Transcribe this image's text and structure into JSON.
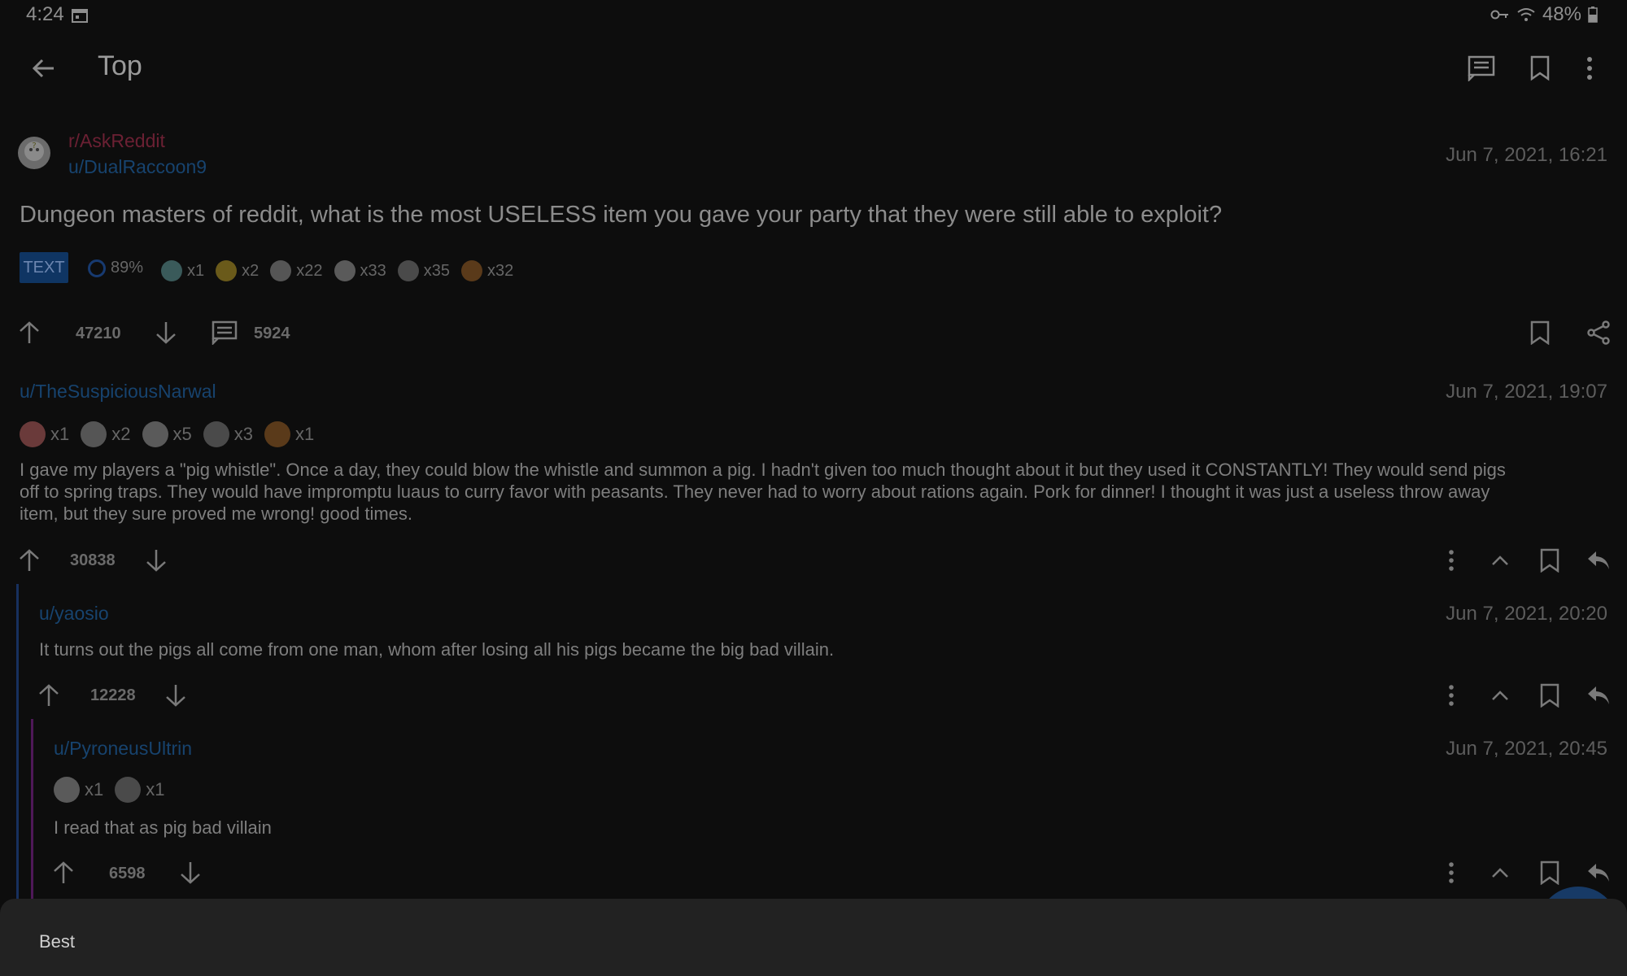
{
  "status_bar": {
    "time": "4:24",
    "battery": "48%"
  },
  "toolbar": {
    "title": "Top"
  },
  "post": {
    "subreddit": "r/AskReddit",
    "author": "u/DualRaccoon9",
    "date": "Jun 7, 2021, 16:21",
    "title": "Dungeon masters of reddit, what is the most USELESS item you gave your party that they were still able to exploit?",
    "type_chip": "TEXT",
    "upvote_ratio": "89%",
    "awards": [
      "x1",
      "x2",
      "x22",
      "x33",
      "x35",
      "x32"
    ],
    "score": "47210",
    "comments": "5924"
  },
  "comments": [
    {
      "author": "u/TheSuspiciousNarwal",
      "date": "Jun 7, 2021, 19:07",
      "awards": [
        "x1",
        "x2",
        "x5",
        "x3",
        "x1"
      ],
      "body_line1": "I gave my players a \"pig whistle\". Once a day, they could blow the whistle and summon a pig. I hadn't given too much thought about it but they used it CONSTANTLY! They would send pigs",
      "body_line2": "off to spring traps. They would have impromptu luaus to curry favor with peasants. They never had to worry about rations again. Pork for dinner! I thought it was just a useless throw away",
      "body_line3": "item, but they sure proved me wrong! good times.",
      "score": "30838"
    },
    {
      "author": "u/yaosio",
      "date": "Jun 7, 2021, 20:20",
      "body": "It turns out the pigs all come from one man, whom after losing all his pigs became the big bad villain.",
      "score": "12228"
    },
    {
      "author": "u/PyroneusUltrin",
      "date": "Jun 7, 2021, 20:45",
      "awards": [
        "x1",
        "x1"
      ],
      "body": "I read that as pig bad villain",
      "score": "6598"
    }
  ],
  "bottom_sheet": {
    "label": "Best"
  },
  "colors": {
    "background": "#0d0d0d",
    "subreddit": "#6b2033",
    "user": "#17436e",
    "chip": "#0f3563",
    "sheet": "#222222"
  }
}
